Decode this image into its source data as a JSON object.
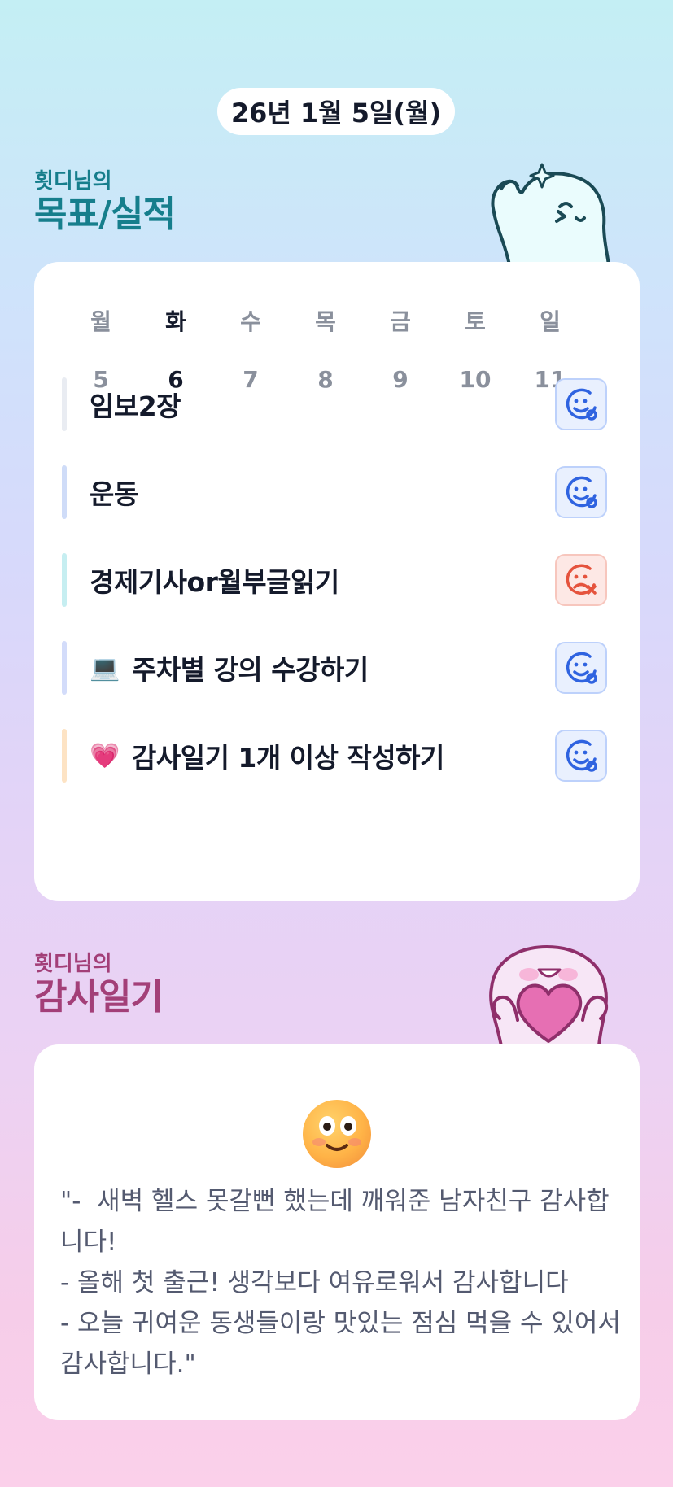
{
  "header": {
    "date": "26년 1월 5일(월)"
  },
  "goals": {
    "owner": "횟디님의",
    "title": "목표/실적",
    "week": {
      "days": [
        "월",
        "화",
        "수",
        "목",
        "금",
        "토",
        "일"
      ],
      "dates": [
        "5",
        "6",
        "7",
        "8",
        "9",
        "10",
        "11"
      ],
      "active_index": 1
    },
    "tasks": [
      {
        "emoji": "",
        "label": "임보2장",
        "status": "done",
        "status_icon": "smile-check-icon",
        "bar_color": "#e9ecf2"
      },
      {
        "emoji": "",
        "label": "운동",
        "status": "done",
        "status_icon": "smile-check-icon",
        "bar_color": "#cfdcf8"
      },
      {
        "emoji": "",
        "label": "경제기사or월부글읽기",
        "status": "fail",
        "status_icon": "frown-x-icon",
        "bar_color": "#c6eef1"
      },
      {
        "emoji": "💻",
        "label": "주차별 강의 수강하기",
        "status": "done",
        "status_icon": "smile-check-icon",
        "bar_color": "#d3dcfa"
      },
      {
        "emoji": "💗",
        "label": "감사일기 1개 이상 작성하기",
        "status": "done",
        "status_icon": "smile-check-icon",
        "bar_color": "#fde3c4"
      }
    ]
  },
  "gratitude": {
    "owner": "횟디님의",
    "title": "감사일기",
    "emoji_icon": "smiling-face-icon",
    "text": "\"-  새벽 헬스 못갈뻔 했는데 깨워준 남자친구 감사합니다!\n- 올해 첫 출근! 생각보다 여유로워서 감사합니다\n- 오늘 귀여운 동생들이랑 맛있는 점심 먹을 수 있어서 감사합니다.\""
  },
  "colors": {
    "goals_accent": "#167e8c",
    "gratitude_accent": "#a33f78",
    "done": "#2f63e0",
    "fail": "#e5533d"
  }
}
